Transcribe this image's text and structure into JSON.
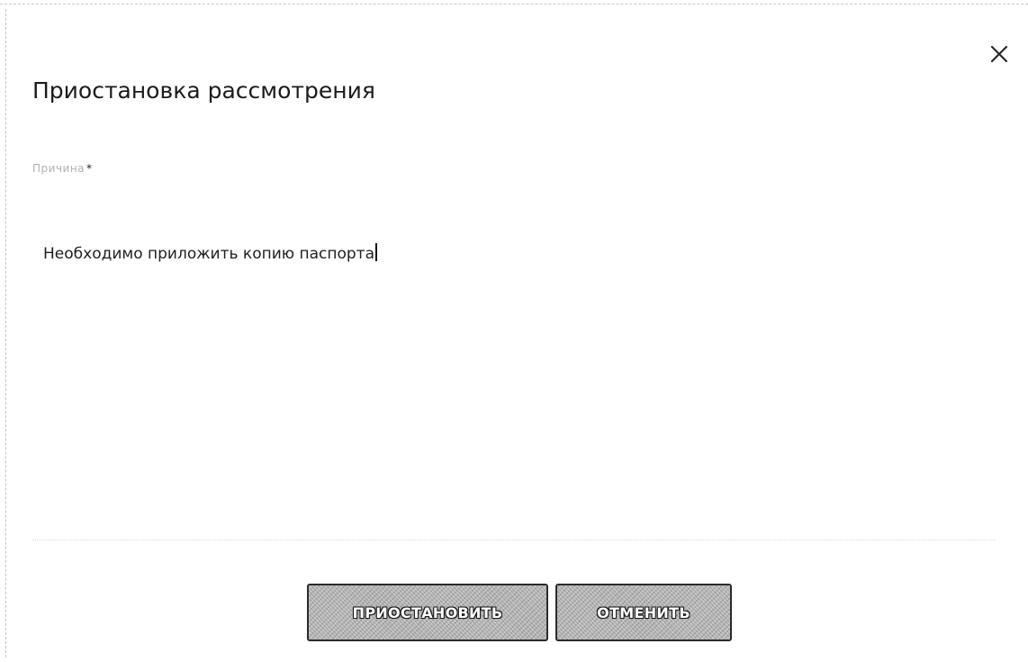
{
  "dialog": {
    "title": "Приостановка рассмотрения",
    "close_icon": "close-icon"
  },
  "form": {
    "reason_label": "Причина",
    "required_mark": "*",
    "reason_value": "Необходимо приложить копию паспорта"
  },
  "actions": {
    "suspend_label": "ПРИОСТАНОВИТЬ",
    "cancel_label": "ОТМЕНИТЬ"
  }
}
